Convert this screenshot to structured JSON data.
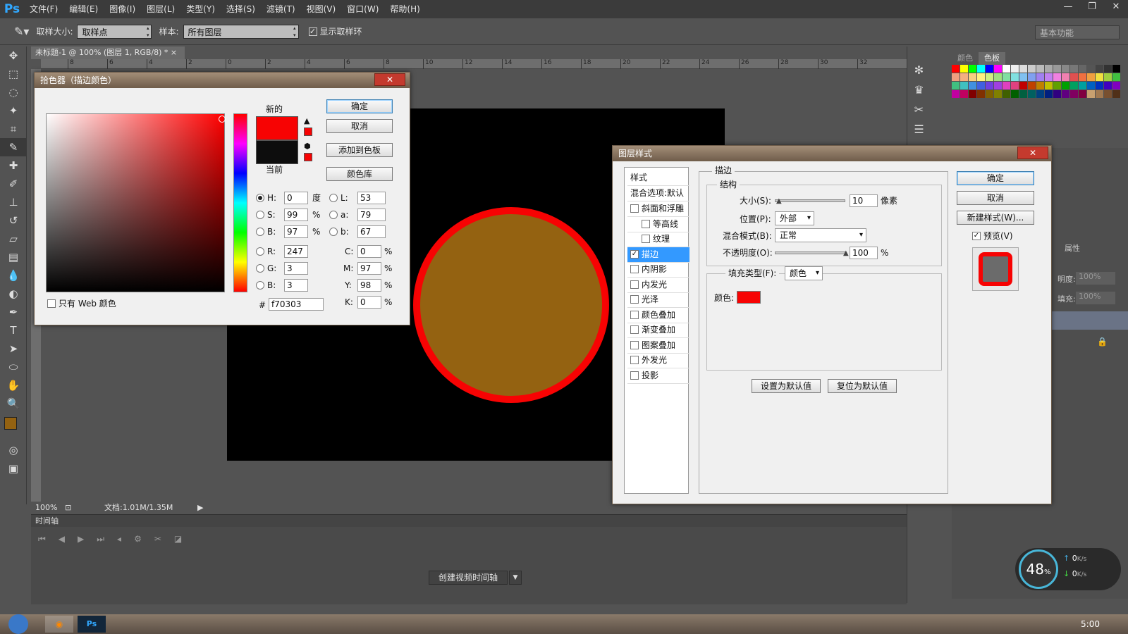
{
  "app": {
    "logo": "Ps"
  },
  "menu": [
    "文件(F)",
    "编辑(E)",
    "图像(I)",
    "图层(L)",
    "类型(Y)",
    "选择(S)",
    "滤镜(T)",
    "视图(V)",
    "窗口(W)",
    "帮助(H)"
  ],
  "window_controls": [
    "—",
    "❐",
    "✕"
  ],
  "options": {
    "sample_size_label": "取样大小:",
    "sample_size_value": "取样点",
    "sample_label": "样本:",
    "sample_value": "所有图层",
    "show_ring_label": "显示取样环",
    "workspace": "基本功能"
  },
  "document": {
    "tab": "未标题-1 @ 100% (图层 1, RGB/8) *",
    "ruler_marks": [
      "8",
      "6",
      "4",
      "2",
      "0",
      "2",
      "4",
      "6",
      "8",
      "10",
      "12",
      "14",
      "16",
      "18",
      "20",
      "22",
      "24",
      "26",
      "28",
      "30",
      "32"
    ],
    "zoom": "100%",
    "doc_info": "文档:1.01M/1.35M"
  },
  "colors": {
    "foreground": "#946211",
    "stroke": "#f70303",
    "canvas": "#000000"
  },
  "timeline": {
    "title": "时间轴",
    "create_button": "创建视频时间轴"
  },
  "right_panel": {
    "tabs": [
      "颜色",
      "色板"
    ],
    "props_tab": "属性",
    "opacity_label": "明度:",
    "opacity_value": "100%",
    "fill_label": "填充:",
    "fill_value": "100%"
  },
  "color_picker": {
    "title": "拾色器（描边颜色）",
    "ok": "确定",
    "cancel": "取消",
    "add_to_swatches": "添加到色板",
    "color_libraries": "颜色库",
    "new_label": "新的",
    "current_label": "当前",
    "new_color": "#f70303",
    "current_color": "#0d0d0d",
    "web_only": "只有 Web 颜色",
    "H": {
      "label": "H:",
      "value": "0",
      "unit": "度"
    },
    "S": {
      "label": "S:",
      "value": "99",
      "unit": "%"
    },
    "Bv": {
      "label": "B:",
      "value": "97",
      "unit": "%"
    },
    "R": {
      "label": "R:",
      "value": "247"
    },
    "G": {
      "label": "G:",
      "value": "3"
    },
    "Bc": {
      "label": "B:",
      "value": "3"
    },
    "L": {
      "label": "L:",
      "value": "53"
    },
    "a": {
      "label": "a:",
      "value": "79"
    },
    "b": {
      "label": "b:",
      "value": "67"
    },
    "C": {
      "label": "C:",
      "value": "0",
      "unit": "%"
    },
    "M": {
      "label": "M:",
      "value": "97",
      "unit": "%"
    },
    "Y": {
      "label": "Y:",
      "value": "98",
      "unit": "%"
    },
    "K": {
      "label": "K:",
      "value": "0",
      "unit": "%"
    },
    "hex_label": "#",
    "hex": "f70303"
  },
  "layer_style": {
    "title": "图层样式",
    "styles_header": "样式",
    "blend_options": "混合选项:默认",
    "items": [
      {
        "label": "斜面和浮雕",
        "checked": false,
        "indent": false
      },
      {
        "label": "等高线",
        "checked": false,
        "indent": true
      },
      {
        "label": "纹理",
        "checked": false,
        "indent": true
      },
      {
        "label": "描边",
        "checked": true,
        "indent": false,
        "selected": true
      },
      {
        "label": "内阴影",
        "checked": false,
        "indent": false
      },
      {
        "label": "内发光",
        "checked": false,
        "indent": false
      },
      {
        "label": "光泽",
        "checked": false,
        "indent": false
      },
      {
        "label": "颜色叠加",
        "checked": false,
        "indent": false
      },
      {
        "label": "渐变叠加",
        "checked": false,
        "indent": false
      },
      {
        "label": "图案叠加",
        "checked": false,
        "indent": false
      },
      {
        "label": "外发光",
        "checked": false,
        "indent": false
      },
      {
        "label": "投影",
        "checked": false,
        "indent": false
      }
    ],
    "section": "描边",
    "structure": "结构",
    "size_label": "大小(S):",
    "size_value": "10",
    "size_unit": "像素",
    "size_fraction": 0.05,
    "position_label": "位置(P):",
    "position_value": "外部",
    "blend_mode_label": "混合模式(B):",
    "blend_mode_value": "正常",
    "opacity_label": "不透明度(O):",
    "opacity_value": "100",
    "opacity_unit": "%",
    "opacity_fraction": 1.0,
    "fill_type_label": "填充类型(F):",
    "fill_type_value": "颜色",
    "color_label": "颜色:",
    "set_default": "设置为默认值",
    "reset_default": "复位为默认值",
    "ok": "确定",
    "cancel": "取消",
    "new_style": "新建样式(W)...",
    "preview_label": "预览(V)"
  },
  "network": {
    "percent": "48",
    "percent_unit": "%",
    "up": "0",
    "down": "0",
    "rate_unit": "K/s"
  },
  "taskbar": {
    "time": "5:00"
  }
}
